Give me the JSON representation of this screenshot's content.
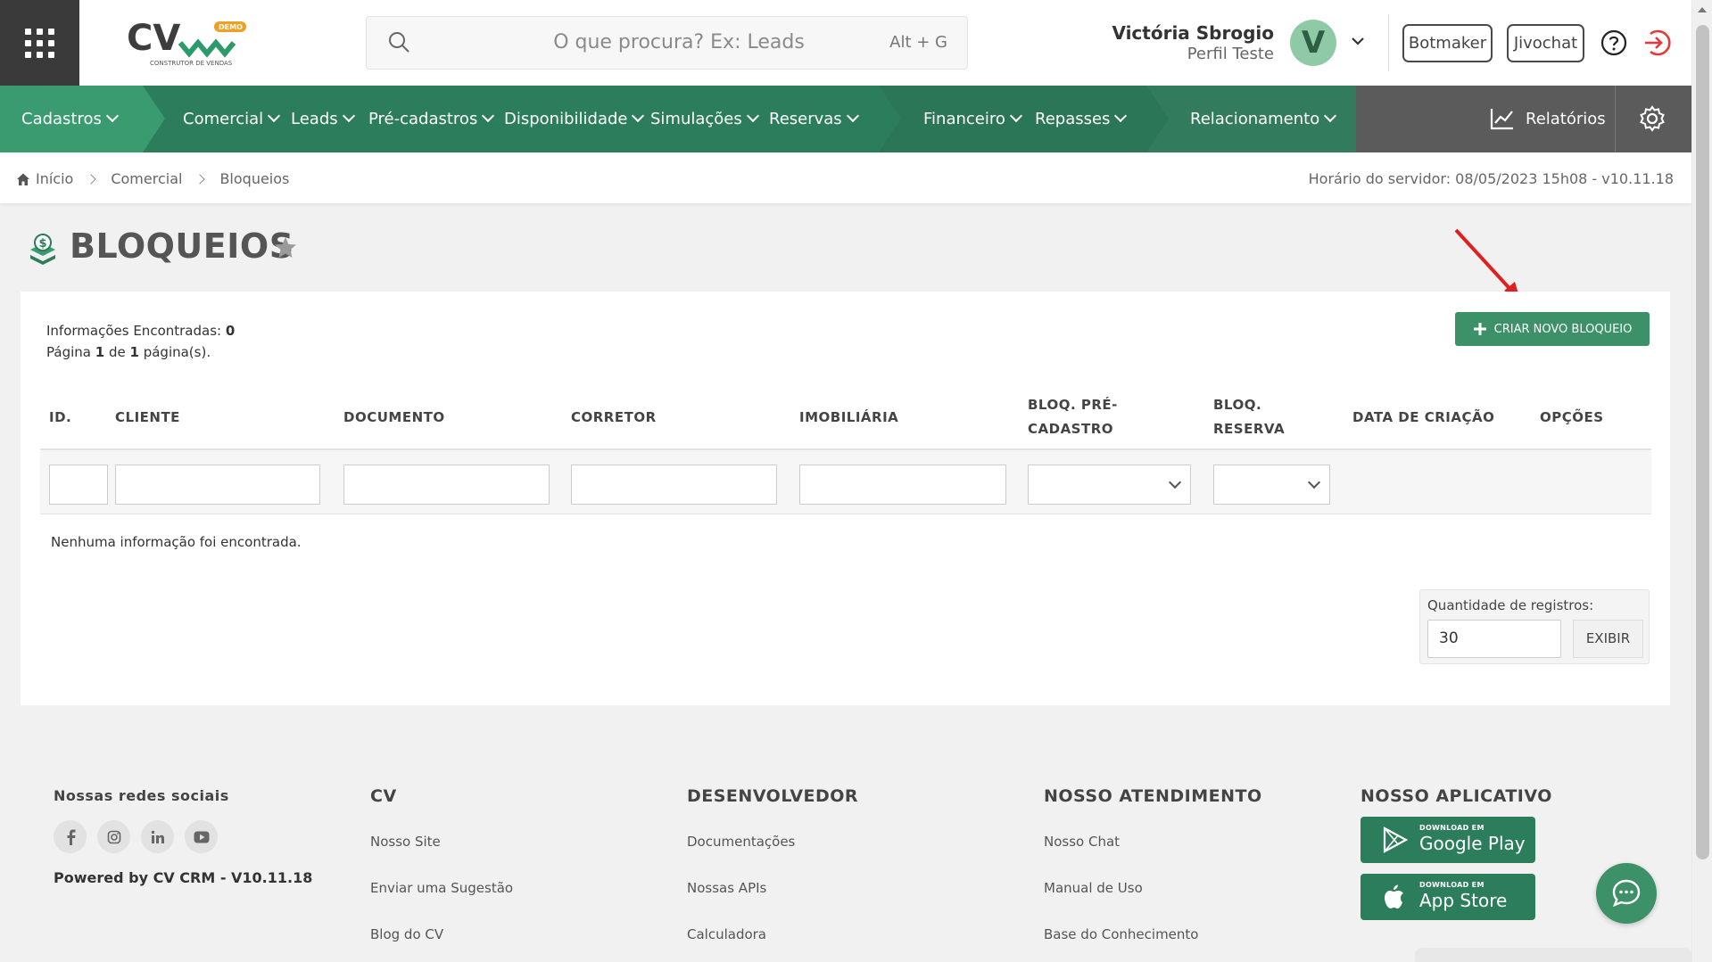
{
  "header": {
    "logo_text": "CV",
    "logo_badge": "DEMO",
    "logo_subtitle": "CONSTRUTOR DE VENDAS",
    "search_placeholder": "O que procura? Ex: Leads",
    "search_shortcut": "Alt + G",
    "user_name": "Victória Sbrogio",
    "user_role": "Perfil Teste",
    "avatar_initial": "V",
    "botmaker_label": "Botmaker",
    "jivochat_label": "Jivochat"
  },
  "nav": {
    "items": [
      {
        "label": "Cadastros"
      },
      {
        "label": "Comercial"
      },
      {
        "label": "Leads"
      },
      {
        "label": "Pré-cadastros"
      },
      {
        "label": "Disponibilidade"
      },
      {
        "label": "Simulações"
      },
      {
        "label": "Reservas"
      },
      {
        "label": "Financeiro"
      },
      {
        "label": "Repasses"
      },
      {
        "label": "Relacionamento"
      }
    ],
    "reports_label": "Relatórios"
  },
  "breadcrumb": {
    "items": [
      "Início",
      "Comercial",
      "Bloqueios"
    ],
    "server_time": "Horário do servidor: 08/05/2023 15h08 - v10.11.18"
  },
  "page": {
    "title": "BLOQUEIOS",
    "info_label": "Informações Encontradas:",
    "info_count": "0",
    "page_prefix": "Página",
    "page_current": "1",
    "page_of": "de",
    "page_total": "1",
    "page_suffix": "página(s).",
    "create_button": "CRIAR NOVO BLOQUEIO",
    "columns": [
      "ID.",
      "CLIENTE",
      "DOCUMENTO",
      "CORRETOR",
      "IMOBILIÁRIA",
      "BLOQ. PRÉ-CADASTRO",
      "BLOQ. RESERVA",
      "DATA DE CRIAÇÃO",
      "OPÇÕES"
    ],
    "empty_message": "Nenhuma informação foi encontrada.",
    "quantity_label": "Quantidade de registros:",
    "quantity_value": "30",
    "show_button": "EXIBIR"
  },
  "footer": {
    "social_title": "Nossas redes sociais",
    "social_icons": [
      "facebook-icon",
      "instagram-icon",
      "linkedin-icon",
      "youtube-icon"
    ],
    "powered": "Powered by CV CRM - V10.11.18",
    "col_cv_title": "CV",
    "col_cv_links": [
      "Nosso Site",
      "Enviar uma Sugestão",
      "Blog do CV"
    ],
    "col_dev_title": "DESENVOLVEDOR",
    "col_dev_links": [
      "Documentações",
      "Nossas APIs",
      "Calculadora"
    ],
    "col_support_title": "NOSSO ATENDIMENTO",
    "col_support_links": [
      "Nosso Chat",
      "Manual de Uso",
      "Base do Conhecimento"
    ],
    "col_app_title": "NOSSO APLICATIVO",
    "google_small": "DOWNLOAD EM",
    "google_big": "Google Play",
    "apple_small": "DOWNLOAD EM",
    "apple_big": "App Store"
  },
  "colors": {
    "brand_green": "#2c7d5b",
    "button_green": "#3d9168",
    "nav_gray": "#5b5b5b",
    "logout_red": "#e53935"
  }
}
